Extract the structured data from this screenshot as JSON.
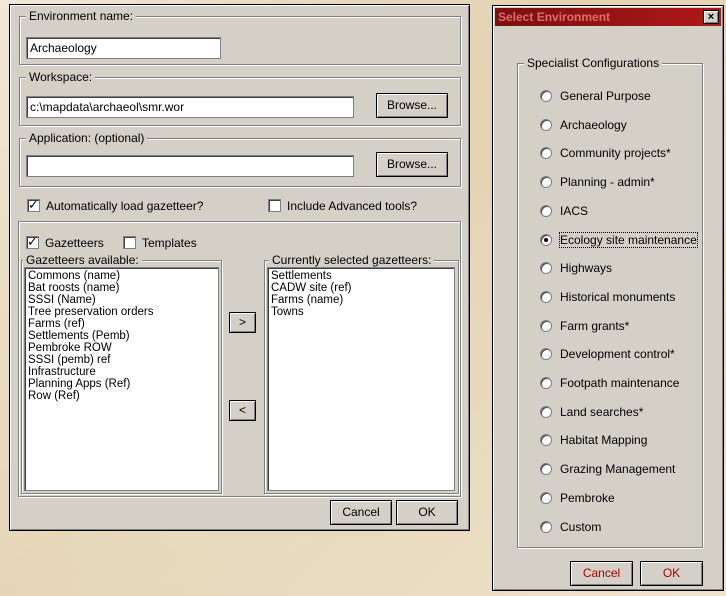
{
  "env_dialog": {
    "env_name_label": "Environment name:",
    "env_name_value": "Archaeology",
    "workspace_label": "Workspace:",
    "workspace_value": "c:\\mapdata\\archaeol\\smr.wor",
    "browse_label": "Browse...",
    "application_label": "Application: (optional)",
    "application_value": "",
    "auto_load_label": "Automatically load gazetteer?",
    "auto_load_checked": true,
    "advanced_label": "Include Advanced tools?",
    "advanced_checked": false,
    "gazetteers_label": "Gazetteers",
    "gazetteers_checked": true,
    "templates_label": "Templates",
    "templates_checked": false,
    "available_label": "Gazetteers available:",
    "available_items": [
      "Commons (name)",
      "Bat roosts (name)",
      "SSSI (Name)",
      "Tree preservation orders",
      "Farms (ref)",
      "Settlements (Pemb)",
      "Pembroke ROW",
      "SSSI (pemb) ref",
      "Infrastructure",
      "Planning Apps (Ref)",
      "Row (Ref)"
    ],
    "selected_label": "Currently selected gazetteers:",
    "selected_items": [
      "Settlements",
      "CADW site (ref)",
      "Farms (name)",
      "Towns"
    ],
    "add_arrow": ">",
    "remove_arrow": "<",
    "cancel_label": "Cancel",
    "ok_label": "OK"
  },
  "select_dialog": {
    "title": "Select Environment",
    "close_glyph": "×",
    "group_label": "Specialist Configurations",
    "selected_index": 5,
    "options": [
      "General Purpose",
      "Archaeology",
      "Community projects*",
      "Planning - admin*",
      "IACS",
      "Ecology site maintenance",
      "Highways",
      "Historical monuments",
      "Farm grants*",
      "Development control*",
      "Footpath maintenance",
      "Land searches*",
      "Habitat Mapping",
      "Grazing Management",
      "Pembroke",
      "Custom"
    ],
    "cancel_label": "Cancel",
    "ok_label": "OK"
  }
}
